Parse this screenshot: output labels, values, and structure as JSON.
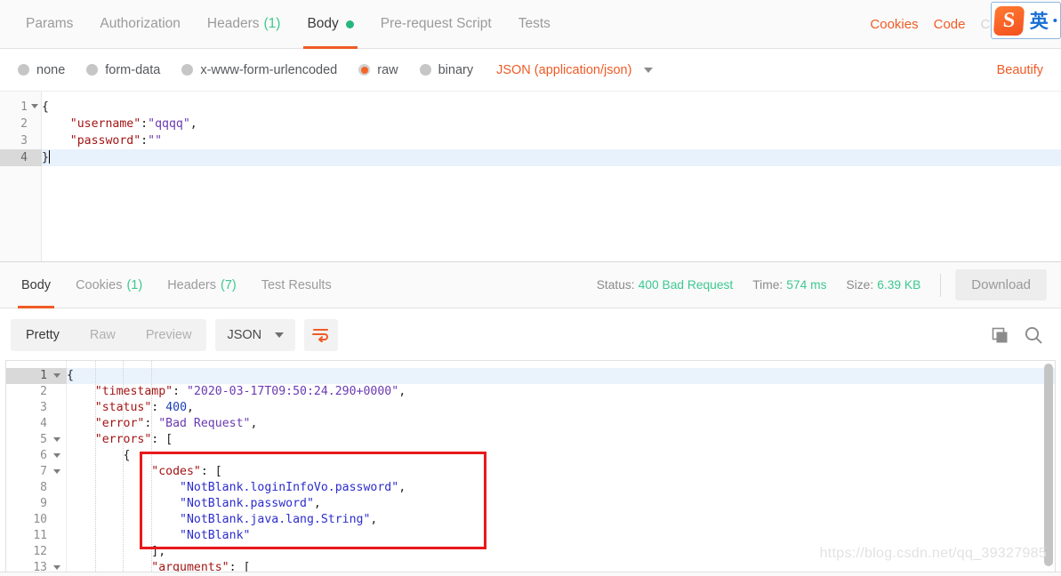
{
  "request_tabs": [
    {
      "label": "Params",
      "active": false,
      "count": null,
      "dot": false
    },
    {
      "label": "Authorization",
      "active": false,
      "count": null,
      "dot": false
    },
    {
      "label": "Headers",
      "active": false,
      "count": "(1)",
      "dot": false
    },
    {
      "label": "Body",
      "active": true,
      "count": null,
      "dot": true
    },
    {
      "label": "Pre-request Script",
      "active": false,
      "count": null,
      "dot": false
    },
    {
      "label": "Tests",
      "active": false,
      "count": null,
      "dot": false
    }
  ],
  "request_header_links": {
    "cookies": "Cookies",
    "code": "Code",
    "comments": "Comments"
  },
  "ime": {
    "logo_letter": "S",
    "mode": "英",
    "dot": "•"
  },
  "body_types": [
    {
      "label": "none",
      "selected": false
    },
    {
      "label": "form-data",
      "selected": false
    },
    {
      "label": "x-www-form-urlencoded",
      "selected": false
    },
    {
      "label": "raw",
      "selected": true
    },
    {
      "label": "binary",
      "selected": false
    }
  ],
  "mime_type": "JSON (application/json)",
  "beautify_label": "Beautify",
  "request_body": {
    "lines": [
      {
        "no": "1",
        "fold": true,
        "active": false,
        "tokens": [
          {
            "t": "{",
            "c": "p"
          }
        ]
      },
      {
        "no": "2",
        "fold": false,
        "active": false,
        "tokens": [
          {
            "t": "    ",
            "c": "p"
          },
          {
            "t": "\"username\"",
            "c": "k"
          },
          {
            "t": ":",
            "c": "p"
          },
          {
            "t": "\"qqqq\"",
            "c": "s"
          },
          {
            "t": ",",
            "c": "p"
          }
        ]
      },
      {
        "no": "3",
        "fold": false,
        "active": false,
        "tokens": [
          {
            "t": "    ",
            "c": "p"
          },
          {
            "t": "\"password\"",
            "c": "k"
          },
          {
            "t": ":",
            "c": "p"
          },
          {
            "t": "\"\"",
            "c": "s"
          }
        ]
      },
      {
        "no": "4",
        "fold": false,
        "active": true,
        "tokens": [
          {
            "t": "}",
            "c": "p"
          }
        ]
      }
    ]
  },
  "response_tabs": [
    {
      "label": "Body",
      "active": true,
      "count": null
    },
    {
      "label": "Cookies",
      "active": false,
      "count": "(1)"
    },
    {
      "label": "Headers",
      "active": false,
      "count": "(7)"
    },
    {
      "label": "Test Results",
      "active": false,
      "count": null
    }
  ],
  "response_meta": {
    "status_label": "Status:",
    "status_value": "400 Bad Request",
    "time_label": "Time:",
    "time_value": "574 ms",
    "size_label": "Size:",
    "size_value": "6.39 KB",
    "download_label": "Download"
  },
  "response_toolbar": {
    "view_modes": [
      {
        "label": "Pretty",
        "active": true
      },
      {
        "label": "Raw",
        "active": false
      },
      {
        "label": "Preview",
        "active": false
      }
    ],
    "format": "JSON",
    "wrap_icon": "word-wrap-icon",
    "copy_icon": "copy-icon",
    "search_icon": "search-icon"
  },
  "response_body": {
    "lines": [
      {
        "no": "1",
        "fold": true,
        "active": true,
        "indents": 0,
        "tokens": [
          {
            "t": "{",
            "c": "p"
          }
        ]
      },
      {
        "no": "2",
        "fold": false,
        "active": false,
        "indents": 0,
        "tokens": [
          {
            "t": "    ",
            "c": "p"
          },
          {
            "t": "\"timestamp\"",
            "c": "k"
          },
          {
            "t": ": ",
            "c": "p"
          },
          {
            "t": "\"2020-03-17T09:50:24.290+0000\"",
            "c": "s"
          },
          {
            "t": ",",
            "c": "p"
          }
        ]
      },
      {
        "no": "3",
        "fold": false,
        "active": false,
        "indents": 0,
        "tokens": [
          {
            "t": "    ",
            "c": "p"
          },
          {
            "t": "\"status\"",
            "c": "k"
          },
          {
            "t": ": ",
            "c": "p"
          },
          {
            "t": "400",
            "c": "n"
          },
          {
            "t": ",",
            "c": "p"
          }
        ]
      },
      {
        "no": "4",
        "fold": false,
        "active": false,
        "indents": 0,
        "tokens": [
          {
            "t": "    ",
            "c": "p"
          },
          {
            "t": "\"error\"",
            "c": "k"
          },
          {
            "t": ": ",
            "c": "p"
          },
          {
            "t": "\"Bad Request\"",
            "c": "s"
          },
          {
            "t": ",",
            "c": "p"
          }
        ]
      },
      {
        "no": "5",
        "fold": true,
        "active": false,
        "indents": 0,
        "tokens": [
          {
            "t": "    ",
            "c": "p"
          },
          {
            "t": "\"errors\"",
            "c": "k"
          },
          {
            "t": ": [",
            "c": "p"
          }
        ]
      },
      {
        "no": "6",
        "fold": true,
        "active": false,
        "indents": 1,
        "tokens": [
          {
            "t": "        {",
            "c": "p"
          }
        ]
      },
      {
        "no": "7",
        "fold": true,
        "active": false,
        "indents": 2,
        "tokens": [
          {
            "t": "            ",
            "c": "p"
          },
          {
            "t": "\"codes\"",
            "c": "k"
          },
          {
            "t": ": [",
            "c": "p"
          }
        ]
      },
      {
        "no": "8",
        "fold": false,
        "active": false,
        "indents": 3,
        "tokens": [
          {
            "t": "                ",
            "c": "p"
          },
          {
            "t": "\"NotBlank.loginInfoVo.password\"",
            "c": "bl"
          },
          {
            "t": ",",
            "c": "p"
          }
        ]
      },
      {
        "no": "9",
        "fold": false,
        "active": false,
        "indents": 3,
        "tokens": [
          {
            "t": "                ",
            "c": "p"
          },
          {
            "t": "\"NotBlank.password\"",
            "c": "bl"
          },
          {
            "t": ",",
            "c": "p"
          }
        ]
      },
      {
        "no": "10",
        "fold": false,
        "active": false,
        "indents": 3,
        "tokens": [
          {
            "t": "                ",
            "c": "p"
          },
          {
            "t": "\"NotBlank.java.lang.String\"",
            "c": "bl"
          },
          {
            "t": ",",
            "c": "p"
          }
        ]
      },
      {
        "no": "11",
        "fold": false,
        "active": false,
        "indents": 3,
        "tokens": [
          {
            "t": "                ",
            "c": "p"
          },
          {
            "t": "\"NotBlank\"",
            "c": "bl"
          }
        ]
      },
      {
        "no": "12",
        "fold": false,
        "active": false,
        "indents": 2,
        "tokens": [
          {
            "t": "            ],",
            "c": "p"
          }
        ]
      },
      {
        "no": "13",
        "fold": true,
        "active": false,
        "indents": 2,
        "tokens": [
          {
            "t": "            ",
            "c": "p"
          },
          {
            "t": "\"arguments\"",
            "c": "k"
          },
          {
            "t": ": [",
            "c": "p"
          }
        ]
      }
    ]
  },
  "annotation": {
    "name": "red-highlight-box",
    "color": "#e8191b"
  },
  "watermark": "https://blog.csdn.net/qq_39327985"
}
